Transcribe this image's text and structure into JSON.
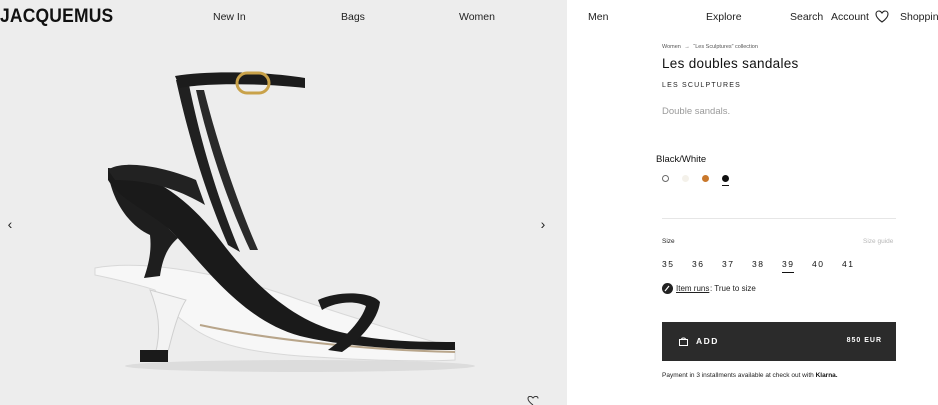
{
  "header": {
    "logo": "JACQUEMUS",
    "nav": {
      "new_in": "New In",
      "bags": "Bags",
      "women": "Women",
      "men": "Men",
      "explore": "Explore",
      "search": "Search",
      "account": "Account",
      "shopping": "Shopping"
    }
  },
  "gallery": {
    "prev_arrow": "‹",
    "next_arrow": "›",
    "image_icon": "sandal-image"
  },
  "product": {
    "breadcrumb": {
      "category": "Women",
      "separator": "→",
      "collection": "“Les Sculptures” collection"
    },
    "title": "Les doubles sandales",
    "line": "LES SCULPTURES",
    "description": "Double sandals.",
    "color_name": "Black/White",
    "colors": [
      {
        "name": "white",
        "hex": "#ffffff",
        "border": "#6b6b6b",
        "selected": false
      },
      {
        "name": "cream",
        "hex": "#f4f1ea",
        "border": "#f4f1ea",
        "selected": false
      },
      {
        "name": "caramel",
        "hex": "#c9782c",
        "border": "#c9782c",
        "selected": false
      },
      {
        "name": "black",
        "hex": "#111111",
        "border": "#111111",
        "selected": true
      }
    ],
    "size_label": "Size",
    "size_guide": "Size guide",
    "sizes": [
      "35",
      "36",
      "37",
      "38",
      "39",
      "40",
      "41"
    ],
    "selected_size": "39",
    "fit": {
      "link": "Item runs",
      "value": ": True to size"
    },
    "add_button": {
      "label": "ADD",
      "price": "850 EUR"
    },
    "payment": {
      "text": "Payment in 3 installments available at check out with",
      "provider": "Klarna."
    }
  },
  "colors": {
    "background_media": "#ededed",
    "button_dark": "#2b2b2b",
    "text": "#111111",
    "muted": "#9a9a9a"
  }
}
